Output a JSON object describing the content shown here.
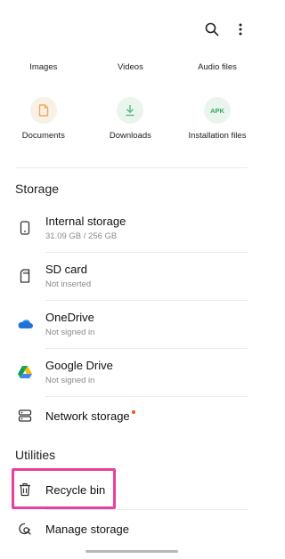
{
  "categories_row1": [
    {
      "label": "Images",
      "icon": "image-icon"
    },
    {
      "label": "Videos",
      "icon": "video-icon"
    },
    {
      "label": "Audio files",
      "icon": "audio-icon"
    }
  ],
  "categories_row2": [
    {
      "label": "Documents",
      "icon": "document-icon",
      "color": "#f0a860"
    },
    {
      "label": "Downloads",
      "icon": "download-icon",
      "color": "#57b889"
    },
    {
      "label": "Installation files",
      "icon": "apk-icon",
      "badge": "APK",
      "color": "#3aa660"
    }
  ],
  "storage": {
    "title": "Storage",
    "items": [
      {
        "title": "Internal storage",
        "subtitle": "31.09 GB / 256 GB",
        "icon": "phone-icon"
      },
      {
        "title": "SD card",
        "subtitle": "Not inserted",
        "icon": "sd-card-icon"
      },
      {
        "title": "OneDrive",
        "subtitle": "Not signed in",
        "icon": "onedrive-icon"
      },
      {
        "title": "Google Drive",
        "subtitle": "Not signed in",
        "icon": "google-drive-icon"
      },
      {
        "title": "Network storage",
        "subtitle": "",
        "icon": "network-storage-icon"
      }
    ]
  },
  "utilities": {
    "title": "Utilities",
    "items": [
      {
        "title": "Recycle bin",
        "icon": "trash-icon"
      },
      {
        "title": "Manage storage",
        "icon": "manage-storage-icon"
      }
    ]
  },
  "colors": {
    "highlight": "#e83fa0",
    "new_dot": "#f0541e",
    "onedrive": "#1f73d6"
  }
}
